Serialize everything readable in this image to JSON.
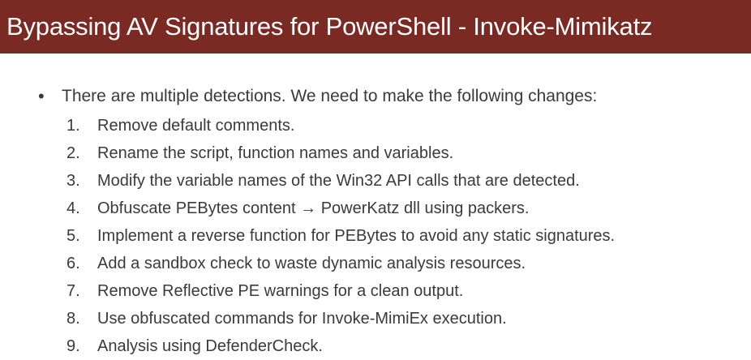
{
  "slide": {
    "title": "Bypassing AV Signatures for PowerShell - Invoke-Mimikatz",
    "bullet_symbol": "•",
    "main_bullet": "There are multiple detections. We need to make the following changes:",
    "steps": [
      {
        "num": "1.",
        "text": "Remove default comments."
      },
      {
        "num": "2.",
        "text": "Rename the script, function names and variables."
      },
      {
        "num": "3.",
        "text": "Modify the variable names of the Win32 API calls that are detected."
      },
      {
        "num": "4.",
        "text": "Obfuscate PEBytes content → PowerKatz dll using packers."
      },
      {
        "num": "5.",
        "text": "Implement a reverse function for PEBytes to avoid any static signatures."
      },
      {
        "num": "6.",
        "text": "Add a sandbox check to waste dynamic analysis resources."
      },
      {
        "num": "7.",
        "text": "Remove Reflective PE warnings for a clean output."
      },
      {
        "num": "8.",
        "text": "Use obfuscated commands for Invoke-MimiEx execution."
      },
      {
        "num": "9.",
        "text": "Analysis using DefenderCheck."
      }
    ]
  },
  "colors": {
    "title_bar": "#7a2a22",
    "title_text": "#ffffff",
    "body_text": "#3a3a3a",
    "background": "#ffffff"
  }
}
